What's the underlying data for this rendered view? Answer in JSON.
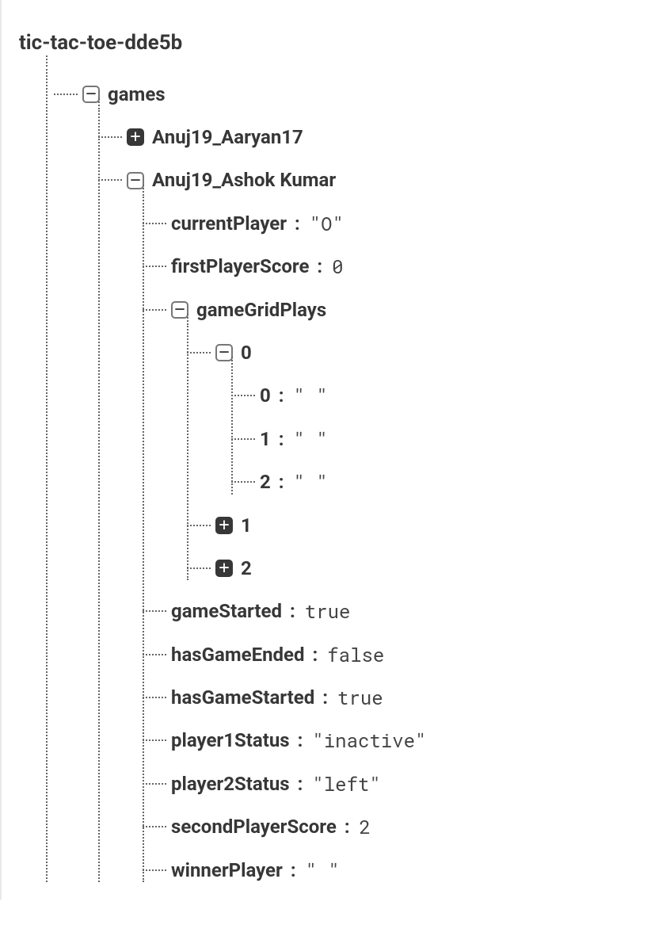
{
  "root": {
    "title": "tic-tac-toe-dde5b"
  },
  "tree": {
    "games_label": "games",
    "game1_label": "Anuj19_Aaryan17",
    "game2_label": "Anuj19_Ashok Kumar",
    "game2": {
      "currentPlayer_key": "currentPlayer",
      "currentPlayer_val": "\"O\"",
      "firstPlayerScore_key": "firstPlayerScore",
      "firstPlayerScore_val": "0",
      "gameGridPlays_key": "gameGridPlays",
      "grid": {
        "row0_label": "0",
        "row0": {
          "c0_key": "0",
          "c0_val": "\" \"",
          "c1_key": "1",
          "c1_val": "\" \"",
          "c2_key": "2",
          "c2_val": "\" \""
        },
        "row1_label": "1",
        "row2_label": "2"
      },
      "gameStarted_key": "gameStarted",
      "gameStarted_val": "true",
      "hasGameEnded_key": "hasGameEnded",
      "hasGameEnded_val": "false",
      "hasGameStarted_key": "hasGameStarted",
      "hasGameStarted_val": "true",
      "player1Status_key": "player1Status",
      "player1Status_val": "\"inactive\"",
      "player2Status_key": "player2Status",
      "player2Status_val": "\"left\"",
      "secondPlayerScore_key": "secondPlayerScore",
      "secondPlayerScore_val": "2",
      "winnerPlayer_key": "winnerPlayer",
      "winnerPlayer_val": "\" \""
    }
  }
}
